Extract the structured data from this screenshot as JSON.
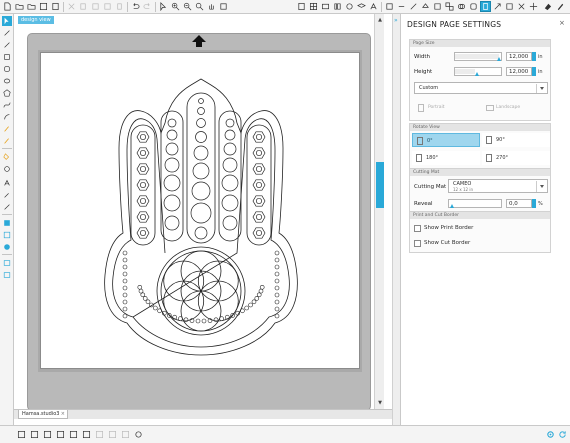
{
  "toolbar": {
    "icons": [
      "new-icon",
      "open-icon",
      "save-icon",
      "print-icon",
      "cut-icon",
      "copy-icon",
      "paste-icon",
      "undo-icon",
      "redo-icon",
      "select-icon",
      "zoom-in-icon",
      "zoom-out-icon",
      "zoom-fit-icon",
      "pan-icon",
      "zoom-page-icon"
    ],
    "right_icons": [
      "page-settings-icon",
      "grid-icon",
      "send-icon",
      "library-icon",
      "store-icon",
      "text-style-icon",
      "line-style-icon",
      "fill-icon",
      "transform-icon",
      "replicate-icon",
      "offset-icon",
      "trace-icon",
      "cut-settings-icon",
      "eraser-icon"
    ]
  },
  "canvas": {
    "view_tag": "design view",
    "doc_tab": "Hamsa.studio3",
    "doc_tab_close": "×"
  },
  "panel": {
    "title": "DESIGN PAGE SETTINGS",
    "close": "×",
    "page_size": {
      "header": "Page Size",
      "width_label": "Width",
      "width_value": "12,000",
      "width_unit": "in",
      "height_label": "Height",
      "height_value": "12,000",
      "height_unit": "in",
      "size_select": "Custom",
      "portrait": "Portrait",
      "landscape": "Landscape"
    },
    "rotate_view": {
      "header": "Rotate View",
      "r0": "0°",
      "r90": "90°",
      "r180": "180°",
      "r270": "270°",
      "selected": "0°"
    },
    "cutting_mat": {
      "header": "Cutting Mat",
      "label": "Cutting Mat",
      "value": "CAMEO",
      "subvalue": "12 x 12 in",
      "reveal_label": "Reveal",
      "reveal_value": "0,0",
      "reveal_unit": "%"
    },
    "print_cut_border": {
      "header": "Print and Cut Border",
      "show_print": "Show Print Border",
      "show_cut": "Show Cut Border"
    }
  },
  "colors": {
    "accent": "#2aa9d8",
    "mat": "#b9b9b9"
  }
}
